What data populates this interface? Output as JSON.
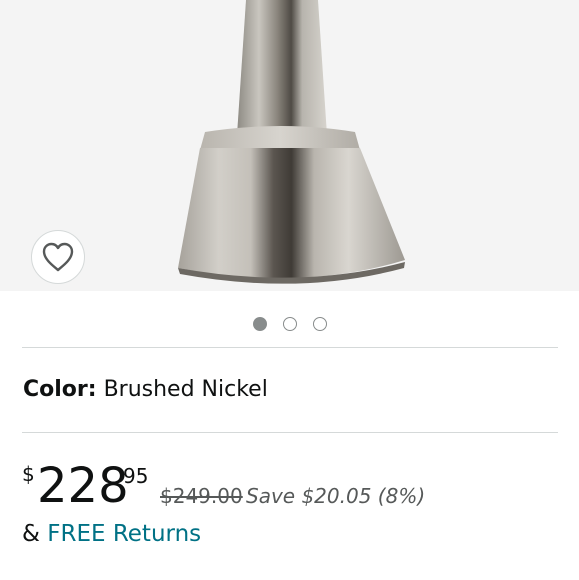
{
  "product": {
    "image_alt": "Brushed nickel lamp base",
    "wishlist_icon": "heart-outline-icon"
  },
  "carousel": {
    "dots": [
      {
        "active": true
      },
      {
        "active": false
      },
      {
        "active": false
      }
    ]
  },
  "color": {
    "label": "Color:",
    "value": "Brushed Nickel"
  },
  "price": {
    "symbol": "$",
    "whole": "228",
    "fraction": "95",
    "list_price": "$249.00",
    "savings": "Save $20.05 (8%)"
  },
  "returns": {
    "prefix": "&",
    "link": "FREE Returns"
  },
  "colors": {
    "link": "#007185",
    "muted": "#565959",
    "text": "#0f1111"
  }
}
